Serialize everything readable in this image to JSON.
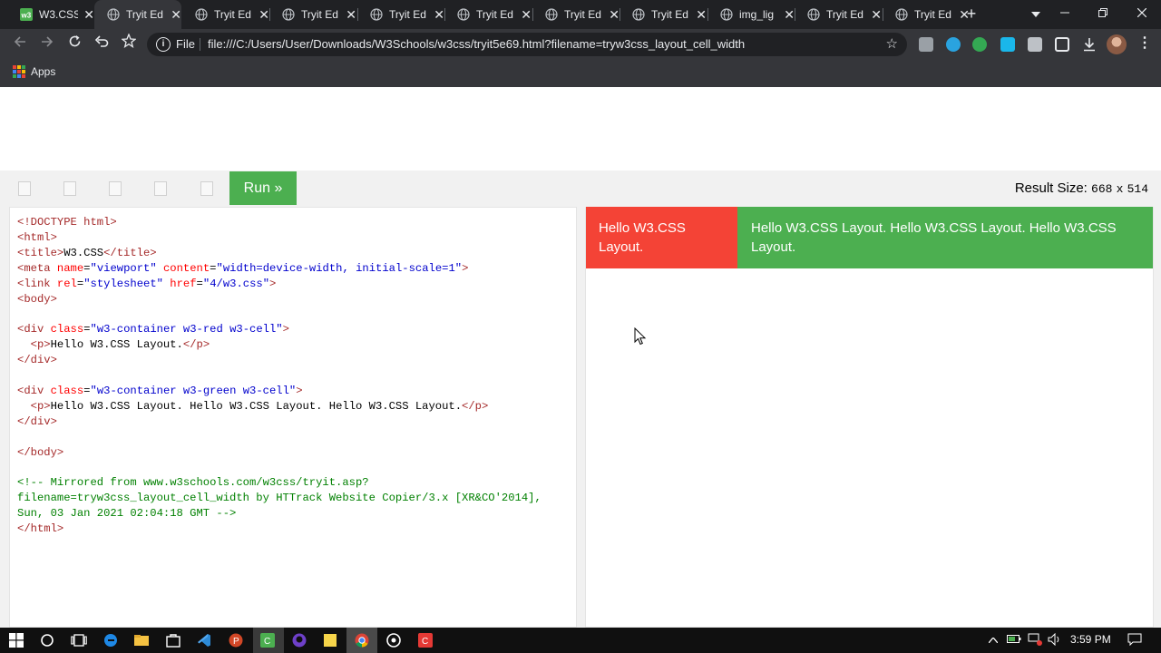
{
  "browser": {
    "tabs": [
      {
        "title": "W3.CSS",
        "icon": "w3schools-green-icon",
        "active": false
      },
      {
        "title": "Tryit Ed",
        "icon": "globe-icon",
        "active": true
      },
      {
        "title": "Tryit Ed",
        "icon": "globe-icon",
        "active": false
      },
      {
        "title": "Tryit Ed",
        "icon": "globe-icon",
        "active": false
      },
      {
        "title": "Tryit Ed",
        "icon": "globe-icon",
        "active": false
      },
      {
        "title": "Tryit Ed",
        "icon": "globe-icon",
        "active": false
      },
      {
        "title": "Tryit Ed",
        "icon": "globe-icon",
        "active": false
      },
      {
        "title": "Tryit Ed",
        "icon": "globe-icon",
        "active": false
      },
      {
        "title": "img_lig",
        "icon": "globe-icon",
        "active": false
      },
      {
        "title": "Tryit Ed",
        "icon": "globe-icon",
        "active": false
      },
      {
        "title": "Tryit Ed",
        "icon": "globe-icon",
        "active": false
      }
    ],
    "new_tab": "+",
    "address": {
      "scheme_label": "File",
      "url": "file:///C:/Users/User/Downloads/W3Schools/w3css/tryit5e69.html?filename=tryw3css_layout_cell_width"
    },
    "bookmarks": {
      "apps_label": "Apps"
    }
  },
  "editor": {
    "run_label": "Run »",
    "result_size_label": "Result Size:",
    "result_width": "668",
    "result_x": "x",
    "result_height": "514"
  },
  "result": {
    "red_cell_text": "Hello W3.CSS Layout.",
    "green_cell_text": "Hello W3.CSS Layout. Hello W3.CSS Layout. Hello W3.CSS Layout."
  },
  "taskbar": {
    "time": "3:59 PM"
  },
  "colors": {
    "w3_red": "#f44336",
    "w3_green": "#4caf50",
    "chrome_dark": "#202124",
    "chrome_toolbar": "#35363a"
  }
}
